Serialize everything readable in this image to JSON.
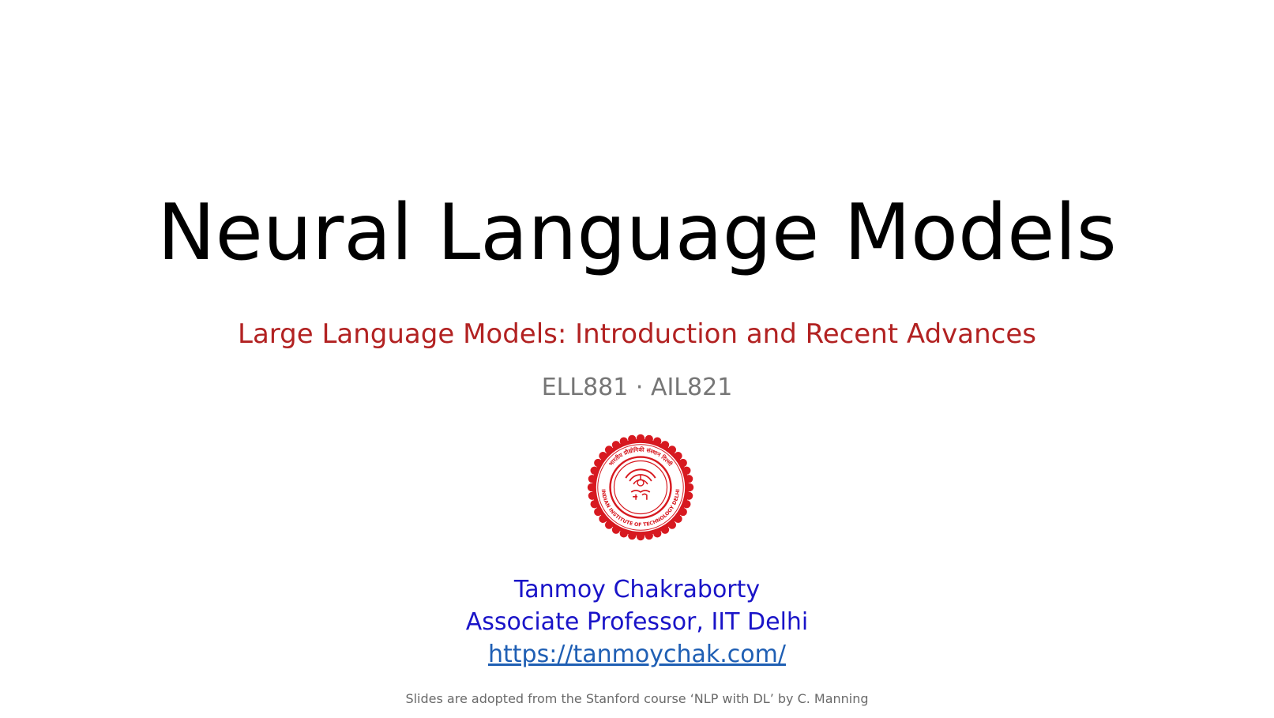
{
  "slide": {
    "title": "Neural Language Models",
    "subtitle": "Large Language Models: Introduction and Recent Advances",
    "course_codes": "ELL881 · AIL821",
    "logo": {
      "icon": "iit-delhi-seal-icon",
      "ring_text": "INDIAN INSTITUTE OF TECHNOLOGY DELHI",
      "top_text": "भारतीय प्रौद्योगिकी संस्थान दिल्ली",
      "color": "#d71920"
    },
    "author": {
      "name": "Tanmoy Chakraborty",
      "position": "Associate Professor, IIT Delhi",
      "website": "https://tanmoychak.com/"
    },
    "footnote": "Slides are adopted from the Stanford course ‘NLP with DL’ by C. Manning"
  },
  "colors": {
    "title": "#000000",
    "subtitle": "#b22222",
    "course": "#767676",
    "author": "#1a14c8",
    "link": "#1f5fb4",
    "footnote": "#6a6a6a"
  }
}
